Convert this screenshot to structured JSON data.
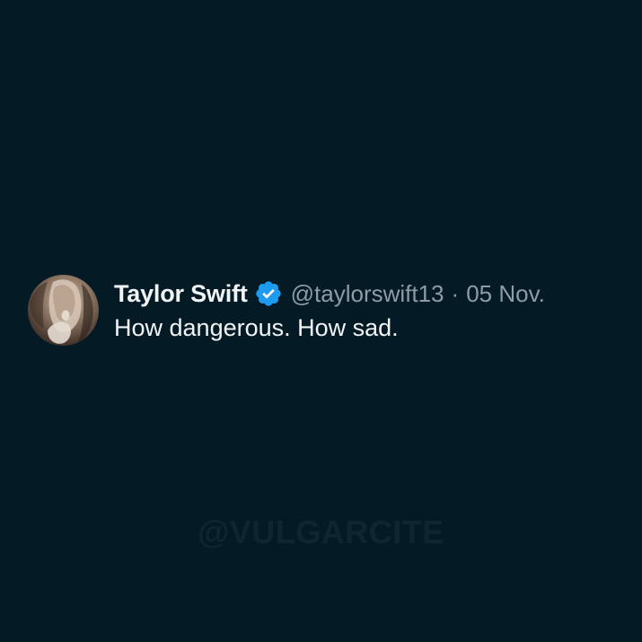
{
  "tweet": {
    "author_name": "Taylor Swift",
    "handle": "@taylorswift13",
    "separator": "·",
    "date": "05 Nov.",
    "text": "How dangerous. How sad.",
    "verified_icon": "verified-badge-icon",
    "avatar_icon": "profile-avatar"
  },
  "watermark": {
    "text": "@VULGARCITE"
  },
  "colors": {
    "background": "#041a24",
    "name": "#f1f4f6",
    "meta": "#8f9ca5",
    "verified": "#1d9bf0",
    "watermark": "#0f2631"
  }
}
